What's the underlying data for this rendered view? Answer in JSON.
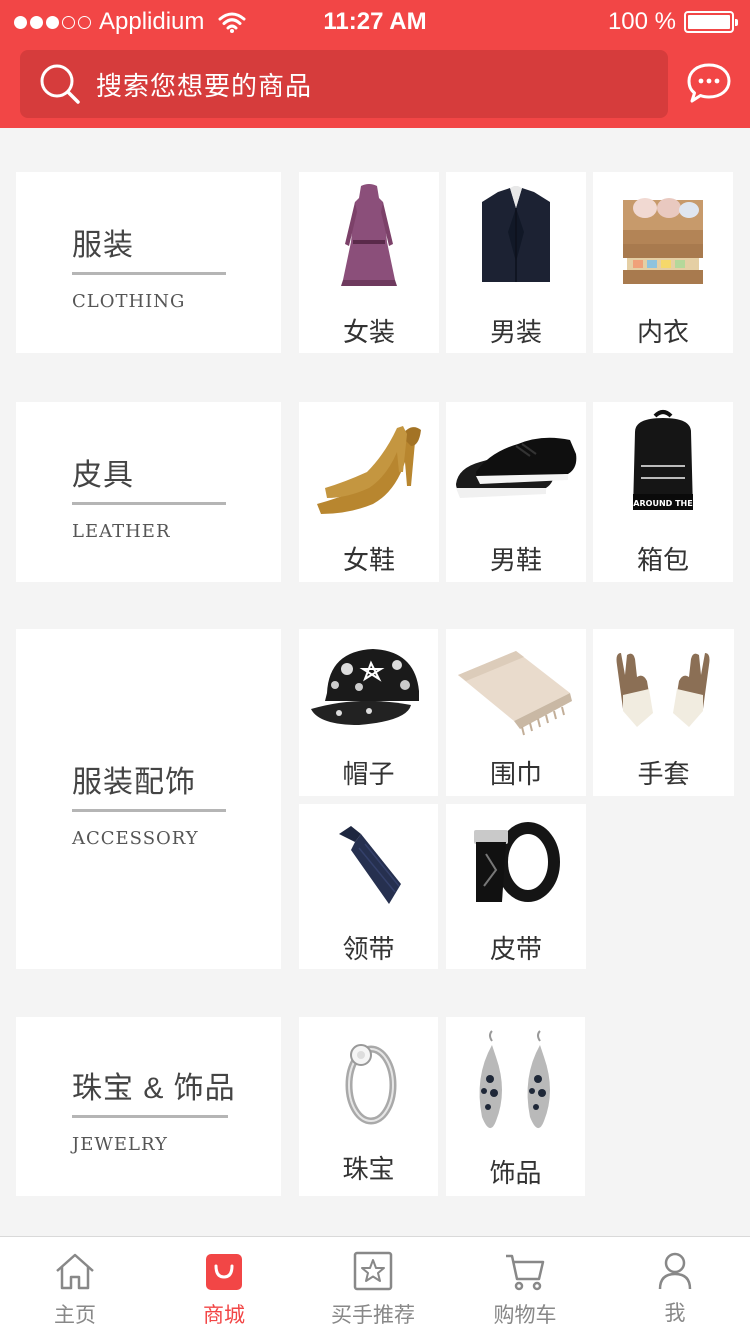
{
  "status_bar": {
    "carrier": "Applidium",
    "time": "11:27 AM",
    "battery": "100 %"
  },
  "search": {
    "placeholder": "搜索您想要的商品"
  },
  "categories": [
    {
      "title": "服装",
      "subtitle": "CLOTHING",
      "items": [
        "女装",
        "男装",
        "内衣"
      ]
    },
    {
      "title": "皮具",
      "subtitle": "LEATHER",
      "items": [
        "女鞋",
        "男鞋",
        "箱包"
      ]
    },
    {
      "title": "服装配饰",
      "subtitle": "ACCESSORY",
      "items": [
        "帽子",
        "围巾",
        "手套",
        "领带",
        "皮带"
      ]
    },
    {
      "title": "珠宝 & 饰品",
      "subtitle": "JEWELRY",
      "items": [
        "珠宝",
        "饰品"
      ]
    }
  ],
  "tabbar": {
    "items": [
      {
        "label": "主页",
        "icon": "home-icon"
      },
      {
        "label": "商城",
        "icon": "shop-bag-icon",
        "active": true
      },
      {
        "label": "买手推荐",
        "icon": "star-icon"
      },
      {
        "label": "购物车",
        "icon": "cart-icon"
      },
      {
        "label": "我",
        "icon": "person-icon"
      }
    ]
  },
  "colors": {
    "brand": "#f24646",
    "search_bg": "#d63c3c",
    "page_bg": "#f4f4f4"
  }
}
